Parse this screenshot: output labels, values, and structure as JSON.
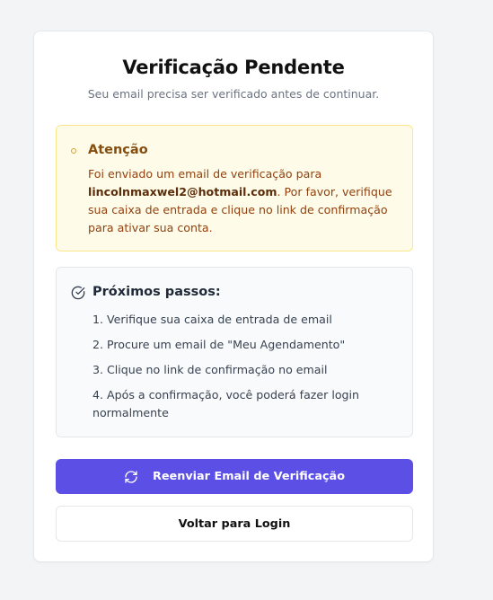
{
  "header": {
    "title": "Verificação Pendente",
    "subtitle": "Seu email precisa ser verificado antes de continuar."
  },
  "alert": {
    "title": "Atenção",
    "text_before": "Foi enviado um email de verificação para ",
    "email": "lincolnmaxwel2@hotmail.com",
    "text_after": ". Por favor, verifique sua caixa de entrada e clique no link de confirmação para ativar sua conta.",
    "icon": "dot-icon"
  },
  "steps": {
    "title": "Próximos passos:",
    "icon": "check-circle-icon",
    "items": [
      "1. Verifique sua caixa de entrada de email",
      "2. Procure um email de \"Meu Agendamento\"",
      "3. Clique no link de confirmação no email",
      "4. Após a confirmação, você poderá fazer login normalmente"
    ]
  },
  "actions": {
    "resend_label": "Reenviar Email de Verificação",
    "resend_icon": "refresh-icon",
    "back_label": "Voltar para Login"
  },
  "colors": {
    "primary": "#5b4fe5",
    "alert_bg": "#fefce8",
    "alert_border": "#fde68a",
    "alert_text": "#92400e"
  }
}
